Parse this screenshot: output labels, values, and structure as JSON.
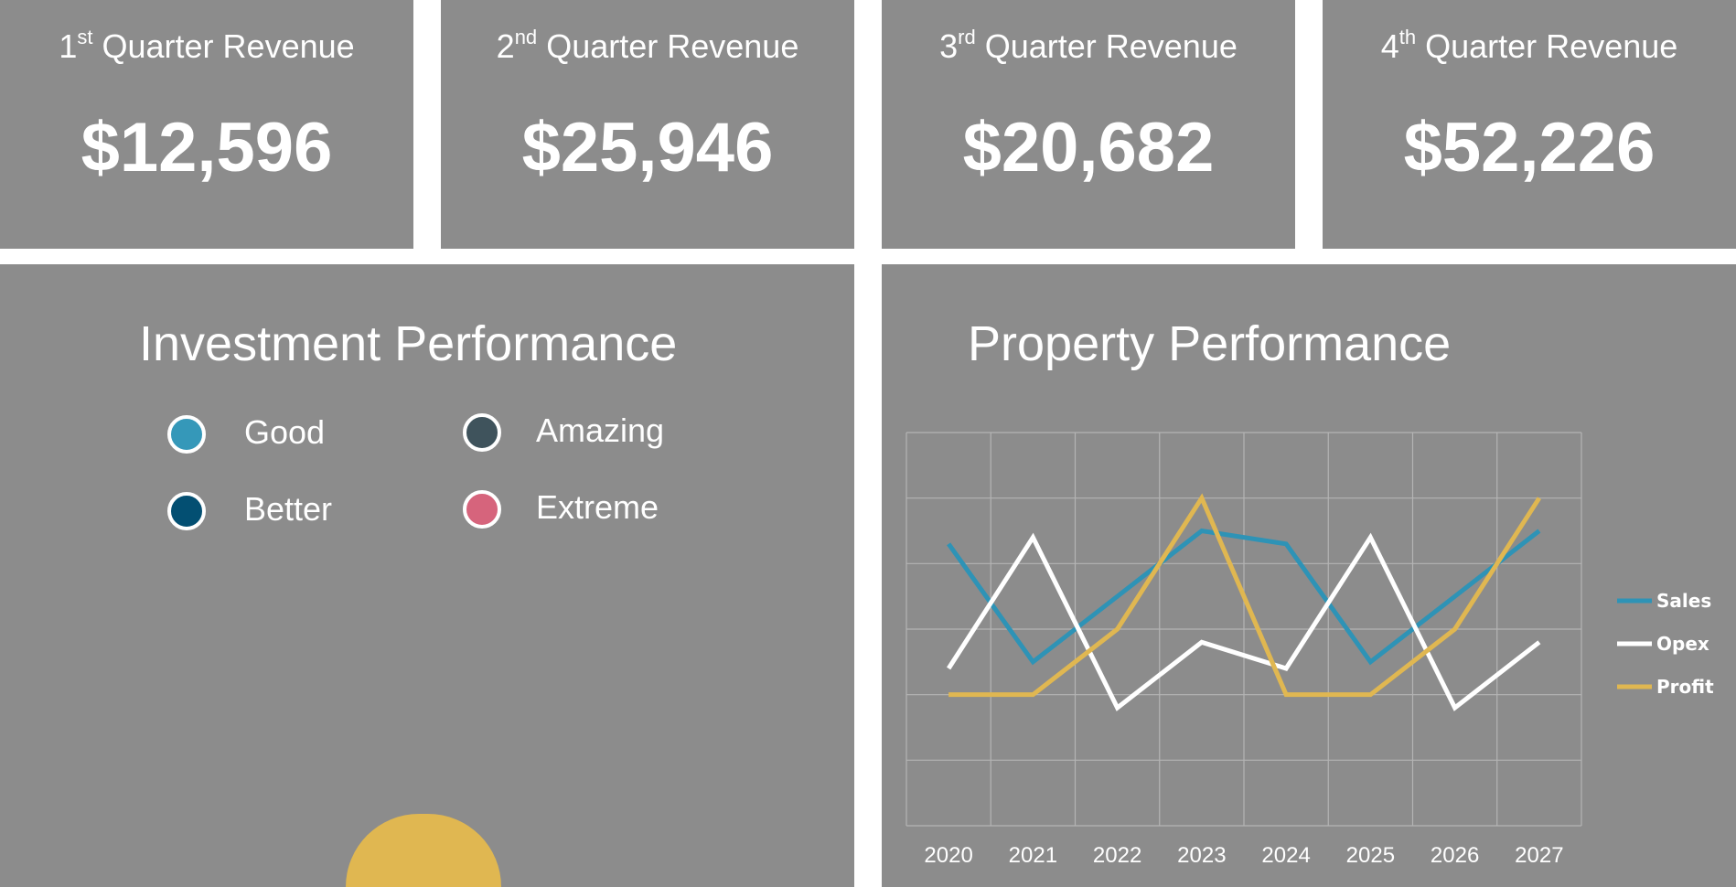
{
  "kpis": [
    {
      "num": "1",
      "suffix": "st",
      "label": "Quarter Revenue",
      "value": "$12,596"
    },
    {
      "num": "2",
      "suffix": "nd",
      "label": "Quarter Revenue",
      "value": "$25,946"
    },
    {
      "num": "3",
      "suffix": "rd",
      "label": "Quarter Revenue",
      "value": "$20,682"
    },
    {
      "num": "4",
      "suffix": "th",
      "label": "Quarter Revenue",
      "value": "$52,226"
    }
  ],
  "investment": {
    "title": "Investment Performance",
    "legend": [
      {
        "label": "Good",
        "color": "#3598b9"
      },
      {
        "label": "Amazing",
        "color": "#3f535c"
      },
      {
        "label": "Better",
        "color": "#034f72"
      },
      {
        "label": "Extreme",
        "color": "#d6647c"
      }
    ],
    "semicircle_color": "#e0b751"
  },
  "property": {
    "title": "Property Performance"
  },
  "chart_data": {
    "type": "line",
    "x": [
      "2020",
      "2021",
      "2022",
      "2023",
      "2024",
      "2025",
      "2026",
      "2027"
    ],
    "ylim": [
      0,
      6
    ],
    "grid": true,
    "legend_position": "right",
    "series": [
      {
        "name": "Sales",
        "color": "#2e93b6",
        "values": [
          4.3,
          2.5,
          3.5,
          4.5,
          4.3,
          2.5,
          3.5,
          4.5
        ]
      },
      {
        "name": "Opex",
        "color": "#ffffff",
        "values": [
          2.4,
          4.4,
          1.8,
          2.8,
          2.4,
          4.4,
          1.8,
          2.8
        ]
      },
      {
        "name": "Profit",
        "color": "#e0b751",
        "values": [
          2.0,
          2.0,
          3.0,
          5.0,
          2.0,
          2.0,
          3.0,
          5.0
        ]
      }
    ]
  }
}
